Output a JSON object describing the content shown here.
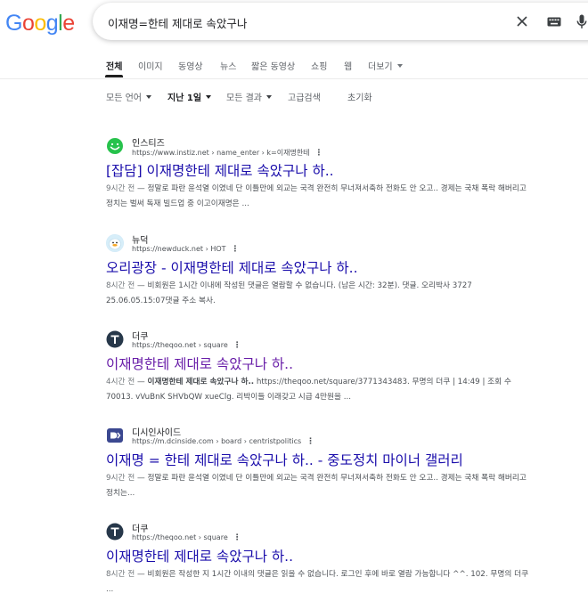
{
  "logo": {
    "letters": [
      "G",
      "o",
      "o",
      "g",
      "l",
      "e"
    ],
    "colors": [
      "#4285F4",
      "#EA4335",
      "#FBBC05",
      "#4285F4",
      "#34A853",
      "#EA4335"
    ]
  },
  "search": {
    "query": "이재명=한테 제대로 속았구나"
  },
  "tabs": [
    "전체",
    "이미지",
    "동영상",
    "뉴스",
    "짧은 동영상",
    "쇼핑",
    "웹",
    "더보기"
  ],
  "tools": {
    "language": "모든 언어",
    "time": "지난 1일",
    "results": "모든 결과",
    "advanced": "고급검색",
    "reset": "초기화"
  },
  "results": [
    {
      "site": "인스티즈",
      "url": "https://www.instiz.net › name_enter › k=이재명한테",
      "title": "[잡담] 이재명한테 제대로 속았구나 하..",
      "visited": false,
      "age": "9시간 전",
      "snippet": "정말로 파란 윤석열 이였네 단 이틀만에 외교는 국격 완전히 무너져서축하 전화도 안 오고.. 경제는 국채 폭락 해버리고정치는 벌써 독재 빌드업 중 이고이재명은 ..."
    },
    {
      "site": "뉴덕",
      "url": "https://newduck.net › HOT",
      "title": "오리광장 - 이재명한테 제대로 속았구나 하..",
      "visited": false,
      "age": "8시간 전",
      "snippet": "비회원은 1시간 이내에 작성된 댓글은 열람할 수 없습니다. (남은 시간: 32분). 댓글. 오리박사 3727 25.06.05.15:07댓글 주소 복사."
    },
    {
      "site": "더쿠",
      "url": "https://theqoo.net › square",
      "title": "이재명한테 제대로 속았구나 하..",
      "visited": true,
      "age": "4시간 전",
      "snippet_bold": "이재명한테 제대로 속았구나 하..",
      "snippet": " https://theqoo.net/square/3771343483. 무명의 더쿠 | 14:49 | 조회 수 70013. vVuBnK SHVbQW xueClg. 리박이들 이래갖고 시급 4만원을 ..."
    },
    {
      "site": "디시인사이드",
      "url": "https://m.dcinside.com › board › centristpolitics",
      "title": "이재명 = 한테 제대로 속았구나 하.. - 중도정치 마이너 갤러리",
      "visited": false,
      "age": "9시간 전",
      "snippet": "정말로 파란 윤석열 이였네 단 이틀만에 외교는 국격 완전히 무너져서축하 전화도 안 오고.. 경제는 국채 폭락 해버리고정치는..."
    },
    {
      "site": "더쿠",
      "url": "https://theqoo.net › square",
      "title": "이재명한테 제대로 속았구나 하..",
      "visited": false,
      "age": "8시간 전",
      "snippet": "비회원은 작성한 지 1시간 이내의 댓글은 읽을 수 없습니다. 로그인 후에 바로 열람 가능합니다 ^^. 102. 무명의 더쿠 ..."
    }
  ],
  "sep": " — ",
  "more_dots": "⋮"
}
